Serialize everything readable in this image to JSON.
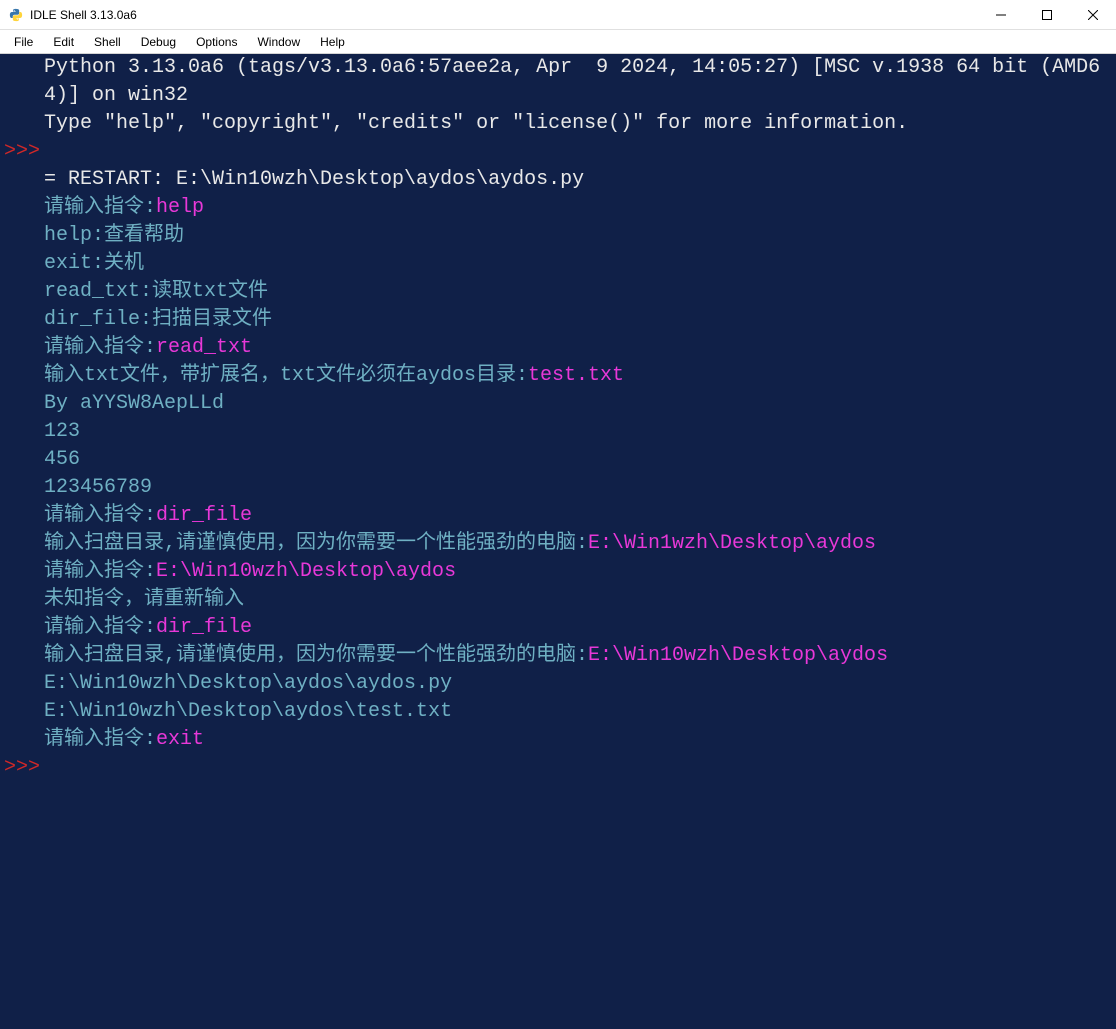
{
  "window": {
    "title": "IDLE Shell 3.13.0a6"
  },
  "menu": {
    "items": [
      "File",
      "Edit",
      "Shell",
      "Debug",
      "Options",
      "Window",
      "Help"
    ]
  },
  "shell": {
    "prompt": ">>>",
    "lines": [
      {
        "g": "",
        "segs": [
          {
            "c": "txt-white",
            "t": "Python 3.13.0a6 (tags/v3.13.0a6:57aee2a, Apr  9 2024, 14:05:27) [MSC v.1938 64 bit (AMD64)] on win32"
          }
        ]
      },
      {
        "g": "",
        "segs": [
          {
            "c": "txt-white",
            "t": "Type \"help\", \"copyright\", \"credits\" or \"license()\" for more information."
          }
        ]
      },
      {
        "g": ">>>",
        "segs": [
          {
            "c": "txt-white",
            "t": ""
          }
        ]
      },
      {
        "g": "",
        "segs": [
          {
            "c": "txt-white",
            "t": "= RESTART: E:\\Win10wzh\\Desktop\\aydos\\aydos.py"
          }
        ]
      },
      {
        "g": "",
        "segs": [
          {
            "c": "txt-cyan",
            "t": "请输入指令:"
          },
          {
            "c": "txt-magenta",
            "t": "help"
          }
        ]
      },
      {
        "g": "",
        "segs": [
          {
            "c": "txt-cyan",
            "t": "help:查看帮助"
          }
        ]
      },
      {
        "g": "",
        "segs": [
          {
            "c": "txt-cyan",
            "t": "exit:关机"
          }
        ]
      },
      {
        "g": "",
        "segs": [
          {
            "c": "txt-cyan",
            "t": "read_txt:读取txt文件"
          }
        ]
      },
      {
        "g": "",
        "segs": [
          {
            "c": "txt-cyan",
            "t": "dir_file:扫描目录文件"
          }
        ]
      },
      {
        "g": "",
        "segs": [
          {
            "c": "txt-cyan",
            "t": "请输入指令:"
          },
          {
            "c": "txt-magenta",
            "t": "read_txt"
          }
        ]
      },
      {
        "g": "",
        "segs": [
          {
            "c": "txt-cyan",
            "t": "输入txt文件，带扩展名，txt文件必须在aydos目录:"
          },
          {
            "c": "txt-magenta",
            "t": "test.txt"
          }
        ]
      },
      {
        "g": "",
        "segs": [
          {
            "c": "txt-cyan",
            "t": "By aYYSW8AepLLd"
          }
        ]
      },
      {
        "g": "",
        "segs": [
          {
            "c": "txt-cyan",
            "t": "123"
          }
        ]
      },
      {
        "g": "",
        "segs": [
          {
            "c": "txt-cyan",
            "t": "456"
          }
        ]
      },
      {
        "g": "",
        "segs": [
          {
            "c": "txt-cyan",
            "t": "123456789"
          }
        ]
      },
      {
        "g": "",
        "segs": [
          {
            "c": "txt-cyan",
            "t": "请输入指令:"
          },
          {
            "c": "txt-magenta",
            "t": "dir_file"
          }
        ]
      },
      {
        "g": "",
        "segs": [
          {
            "c": "txt-cyan",
            "t": "输入扫盘目录,请谨慎使用，因为你需要一个性能强劲的电脑:"
          },
          {
            "c": "txt-magenta",
            "t": "E:\\Win1wzh\\Desktop\\aydos"
          }
        ]
      },
      {
        "g": "",
        "segs": [
          {
            "c": "txt-cyan",
            "t": "请输入指令:"
          },
          {
            "c": "txt-magenta",
            "t": "E:\\Win10wzh\\Desktop\\aydos"
          }
        ]
      },
      {
        "g": "",
        "segs": [
          {
            "c": "txt-cyan",
            "t": "未知指令，请重新输入"
          }
        ]
      },
      {
        "g": "",
        "segs": [
          {
            "c": "txt-cyan",
            "t": "请输入指令:"
          },
          {
            "c": "txt-magenta",
            "t": "dir_file"
          }
        ]
      },
      {
        "g": "",
        "segs": [
          {
            "c": "txt-cyan",
            "t": "输入扫盘目录,请谨慎使用，因为你需要一个性能强劲的电脑:"
          },
          {
            "c": "txt-magenta",
            "t": "E:\\Win10wzh\\Desktop\\aydos"
          }
        ]
      },
      {
        "g": "",
        "segs": [
          {
            "c": "txt-cyan",
            "t": "E:\\Win10wzh\\Desktop\\aydos\\aydos.py"
          }
        ]
      },
      {
        "g": "",
        "segs": [
          {
            "c": "txt-cyan",
            "t": "E:\\Win10wzh\\Desktop\\aydos\\test.txt"
          }
        ]
      },
      {
        "g": "",
        "segs": [
          {
            "c": "txt-cyan",
            "t": "请输入指令:"
          },
          {
            "c": "txt-magenta",
            "t": "exit"
          }
        ]
      },
      {
        "g": ">>>",
        "segs": [
          {
            "c": "txt-white",
            "t": ""
          }
        ]
      }
    ]
  }
}
